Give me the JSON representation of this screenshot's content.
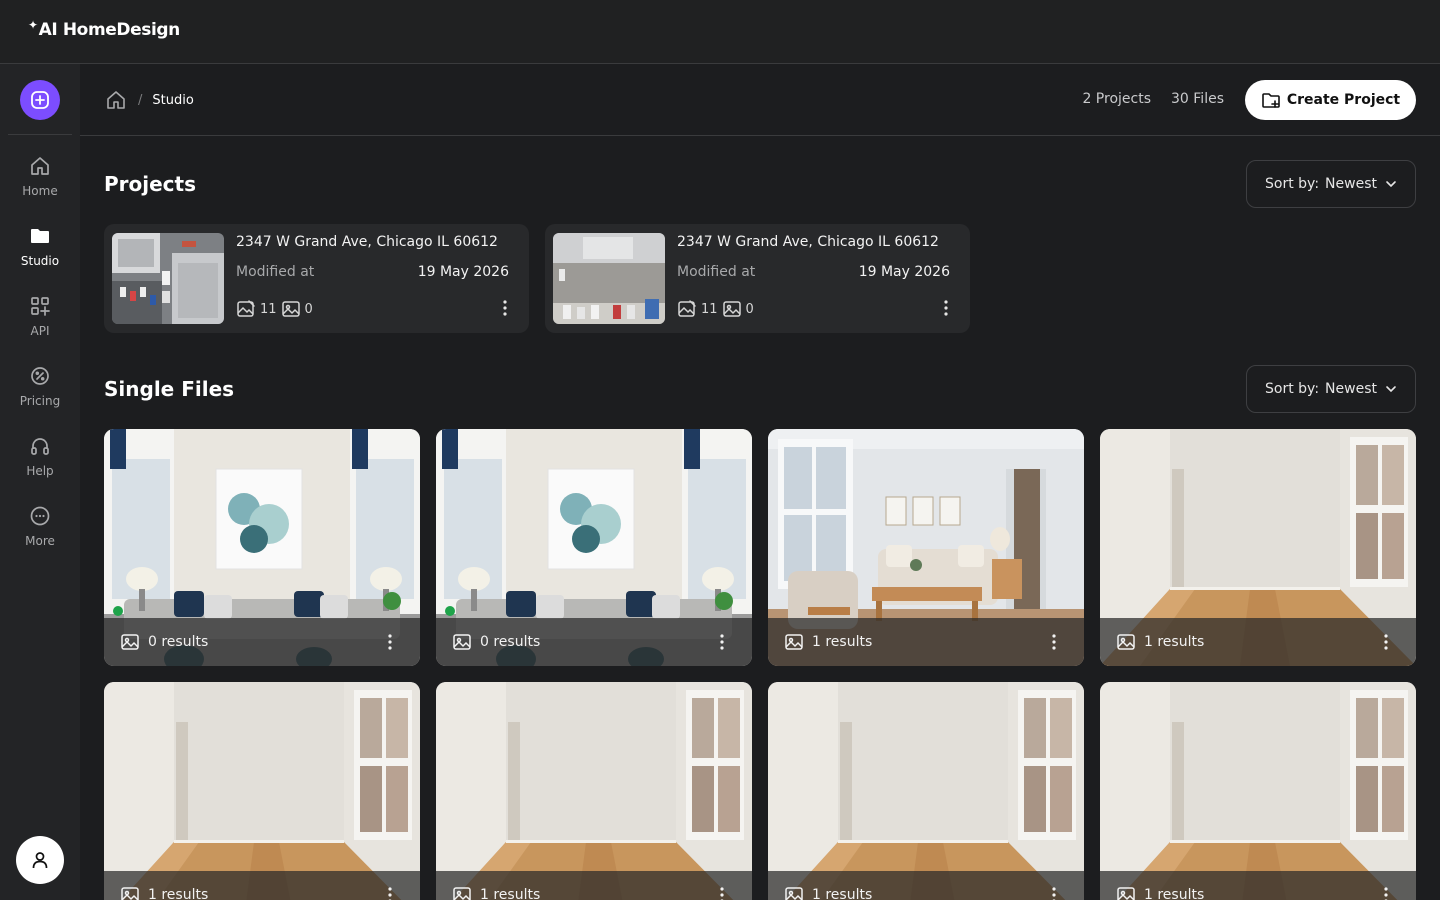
{
  "app": {
    "brand": "AI HomeDesign"
  },
  "sidebar": {
    "new_button_icon": "plus-circle-icon",
    "items": [
      {
        "label": "Home",
        "icon": "home-icon"
      },
      {
        "label": "Studio",
        "icon": "folder-icon",
        "active": true
      },
      {
        "label": "API",
        "icon": "grid-plus-icon"
      },
      {
        "label": "Pricing",
        "icon": "percent-badge-icon"
      },
      {
        "label": "Help",
        "icon": "headphones-icon"
      },
      {
        "label": "More",
        "icon": "dots-circle-icon"
      }
    ],
    "avatar_icon": "user-icon"
  },
  "header": {
    "breadcrumb": {
      "separator": "/",
      "current": "Studio"
    },
    "projects_count": "2 Projects",
    "files_count": "30 Files",
    "create_label": "Create Project"
  },
  "projects": {
    "title": "Projects",
    "sort_label": "Sort by:",
    "sort_value": "Newest",
    "items": [
      {
        "address": "2347 W Grand Ave, Chicago IL 60612",
        "modified_label": "Modified at",
        "date": "19 May 2026",
        "edits": "11",
        "images": "0"
      },
      {
        "address": "2347 W Grand Ave, Chicago IL 60612",
        "modified_label": "Modified at",
        "date": "19 May 2026",
        "edits": "11",
        "images": "0"
      }
    ]
  },
  "files": {
    "title": "Single Files",
    "sort_label": "Sort by:",
    "sort_value": "Newest",
    "items": [
      {
        "results": "0 results"
      },
      {
        "results": "0 results"
      },
      {
        "results": "1 results"
      },
      {
        "results": "1 results"
      },
      {
        "results": "1 results"
      },
      {
        "results": "1 results"
      },
      {
        "results": "1 results"
      },
      {
        "results": "1 results"
      }
    ]
  },
  "colors": {
    "accent": "#7c4dff",
    "background": "#1c1d1f",
    "panel": "#28292b"
  }
}
